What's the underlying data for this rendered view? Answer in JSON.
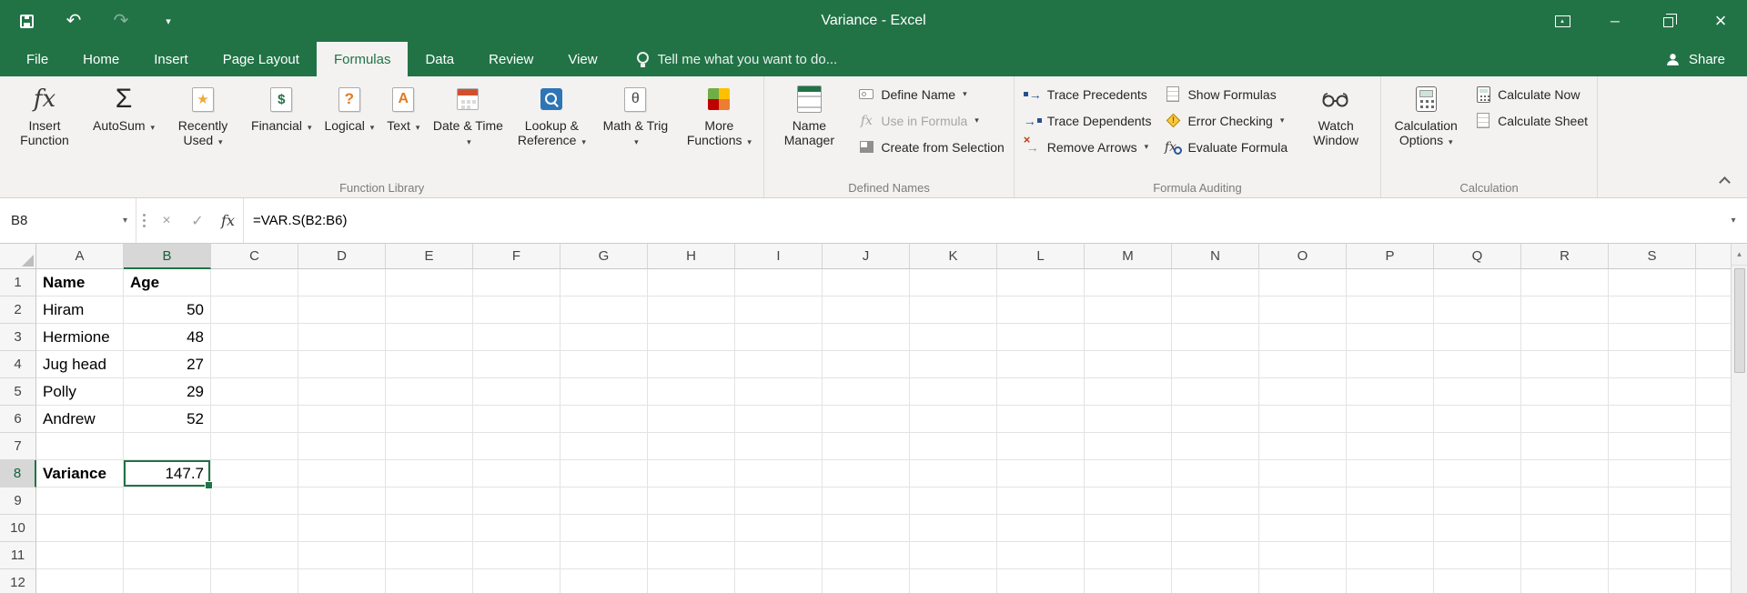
{
  "titlebar": {
    "title": "Variance - Excel"
  },
  "tabs": {
    "items": [
      "File",
      "Home",
      "Insert",
      "Page Layout",
      "Formulas",
      "Data",
      "Review",
      "View"
    ],
    "active": "Formulas",
    "tell_me": "Tell me what you want to do...",
    "share": "Share"
  },
  "ribbon": {
    "function_library": {
      "label": "Function Library",
      "insert_function": "Insert Function",
      "autosum": "AutoSum",
      "recently_used": "Recently Used",
      "financial": "Financial",
      "logical": "Logical",
      "text": "Text",
      "date_time": "Date & Time",
      "lookup_reference": "Lookup & Reference",
      "math_trig": "Math & Trig",
      "more_functions": "More Functions"
    },
    "defined_names": {
      "label": "Defined Names",
      "name_manager": "Name Manager",
      "define_name": "Define Name",
      "use_in_formula": "Use in Formula",
      "create_from_selection": "Create from Selection"
    },
    "formula_auditing": {
      "label": "Formula Auditing",
      "trace_precedents": "Trace Precedents",
      "trace_dependents": "Trace Dependents",
      "remove_arrows": "Remove Arrows",
      "show_formulas": "Show Formulas",
      "error_checking": "Error Checking",
      "evaluate_formula": "Evaluate Formula",
      "watch_window": "Watch Window"
    },
    "calculation": {
      "label": "Calculation",
      "calculation_options": "Calculation Options",
      "calculate_now": "Calculate Now",
      "calculate_sheet": "Calculate Sheet"
    }
  },
  "formula_bar": {
    "name_box": "B8",
    "formula": "=VAR.S(B2:B6)"
  },
  "grid": {
    "columns": [
      "A",
      "B",
      "C",
      "D",
      "E",
      "F",
      "G",
      "H",
      "I",
      "J",
      "K",
      "L",
      "M",
      "N",
      "O",
      "P",
      "Q",
      "R",
      "S"
    ],
    "selected_column": "B",
    "selected_row": 8,
    "selected_cell": "B8",
    "bold_cells": [
      "A1",
      "B1",
      "A8"
    ],
    "rows": [
      {
        "n": 1,
        "cells": {
          "A": "Name",
          "B": "Age"
        }
      },
      {
        "n": 2,
        "cells": {
          "A": "Hiram",
          "B": "50"
        }
      },
      {
        "n": 3,
        "cells": {
          "A": "Hermione",
          "B": "48"
        }
      },
      {
        "n": 4,
        "cells": {
          "A": "Jug head",
          "B": "27"
        }
      },
      {
        "n": 5,
        "cells": {
          "A": "Polly",
          "B": "29"
        }
      },
      {
        "n": 6,
        "cells": {
          "A": "Andrew",
          "B": "52"
        }
      },
      {
        "n": 7,
        "cells": {}
      },
      {
        "n": 8,
        "cells": {
          "A": "Variance",
          "B": "147.7"
        }
      },
      {
        "n": 9,
        "cells": {}
      },
      {
        "n": 10,
        "cells": {}
      },
      {
        "n": 11,
        "cells": {}
      },
      {
        "n": 12,
        "cells": {}
      }
    ]
  },
  "icons": {
    "autosum": "Σ",
    "fx": "fx",
    "theta": "θ",
    "question": "?",
    "letter_a": "A",
    "star": "★",
    "dollar": "$",
    "arrow": "→",
    "dropdown": "▾",
    "cancel": "×",
    "enter": "✓",
    "up_triangle": "▴",
    "undo": "↶",
    "redo": "↷",
    "minimize": "─",
    "close": "×",
    "exclaim": "!"
  },
  "colors": {
    "excel_green": "#217346",
    "selection_border": "#217346"
  }
}
